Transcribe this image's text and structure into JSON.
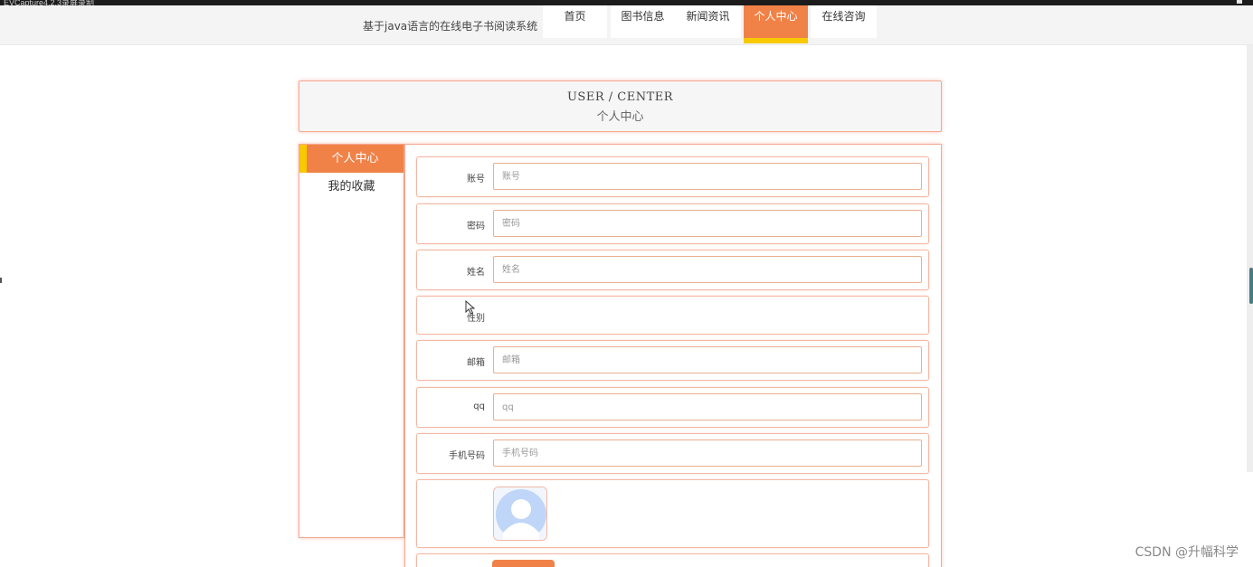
{
  "window": {
    "title_bar_text": "EVCapture4.2.3录屏录制"
  },
  "site": {
    "brand": "基于java语言的在线电子书阅读系统"
  },
  "nav": {
    "items": [
      {
        "label": "首页",
        "active": false
      },
      {
        "label": "图书信息",
        "active": false
      },
      {
        "label": "新闻资讯",
        "active": false
      },
      {
        "label": "个人中心",
        "active": true
      },
      {
        "label": "在线咨询",
        "active": false
      }
    ]
  },
  "page_header": {
    "en": "USER / CENTER",
    "cn": "个人中心"
  },
  "sidebar": {
    "items": [
      {
        "label": "个人中心",
        "active": true
      },
      {
        "label": "我的收藏",
        "active": false
      }
    ]
  },
  "form": {
    "account": {
      "label": "账号",
      "placeholder": "账号"
    },
    "password": {
      "label": "密码",
      "placeholder": "密码"
    },
    "name": {
      "label": "姓名",
      "placeholder": "姓名"
    },
    "gender": {
      "label": "性别"
    },
    "email": {
      "label": "邮箱",
      "placeholder": "邮箱"
    },
    "qq": {
      "label": "qq",
      "placeholder": "qq"
    },
    "phone": {
      "label": "手机号码",
      "placeholder": "手机号码"
    },
    "avatar": {
      "icon": "user-avatar-icon"
    }
  },
  "watermark": "CSDN @升幅科学",
  "colors": {
    "accent": "#f08248",
    "highlight": "#f7c900",
    "border": "#f6a792"
  }
}
